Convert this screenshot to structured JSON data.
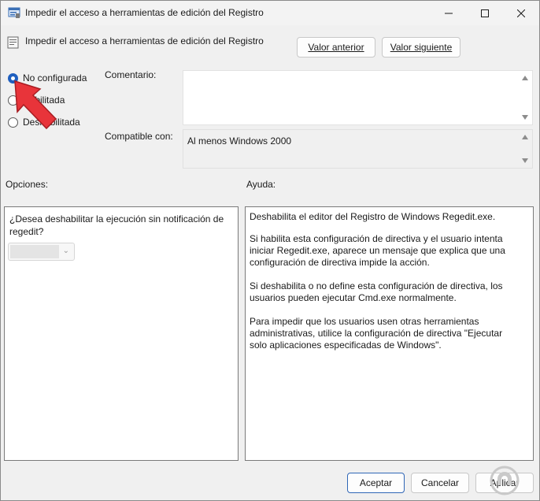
{
  "window": {
    "title": "Impedir el acceso a herramientas de edición del Registro",
    "controls": [
      "minimize-icon",
      "maximize-icon",
      "close-icon"
    ]
  },
  "header": {
    "policy_title": "Impedir el acceso a herramientas de edición del Registro",
    "prev_button": "Valor anterior",
    "next_button": "Valor siguiente"
  },
  "state": {
    "options": [
      {
        "label": "No configurada",
        "selected": true
      },
      {
        "label": "Habilitada",
        "selected": false
      },
      {
        "label": "Deshabilitada",
        "selected": false
      }
    ]
  },
  "comment": {
    "label": "Comentario:",
    "value": ""
  },
  "compat": {
    "label": "Compatible con:",
    "value": "Al menos Windows 2000"
  },
  "options_panel": {
    "label": "Opciones:",
    "question": "¿Desea deshabilitar la ejecución sin notificación de regedit?",
    "select_value": ""
  },
  "help_panel": {
    "label": "Ayuda:",
    "paragraphs": [
      "Deshabilita el editor del Registro de Windows Regedit.exe.",
      "Si habilita esta configuración de directiva y el usuario intenta iniciar Regedit.exe, aparece un mensaje que explica que una configuración de directiva impide la acción.",
      "Si deshabilita o no define esta configuración de directiva, los usuarios pueden ejecutar Cmd.exe normalmente.",
      "Para impedir que los usuarios usen otras herramientas administrativas, utilice la configuración de directiva \"Ejecutar solo aplicaciones especificadas de Windows\"."
    ]
  },
  "footer": {
    "ok_button": "Aceptar",
    "cancel_button": "Cancelar",
    "apply_button": "Aplicar"
  },
  "colors": {
    "accent": "#1f5fbf",
    "annotation_arrow": "#e8343a",
    "watermark": "#c9c9c9"
  }
}
